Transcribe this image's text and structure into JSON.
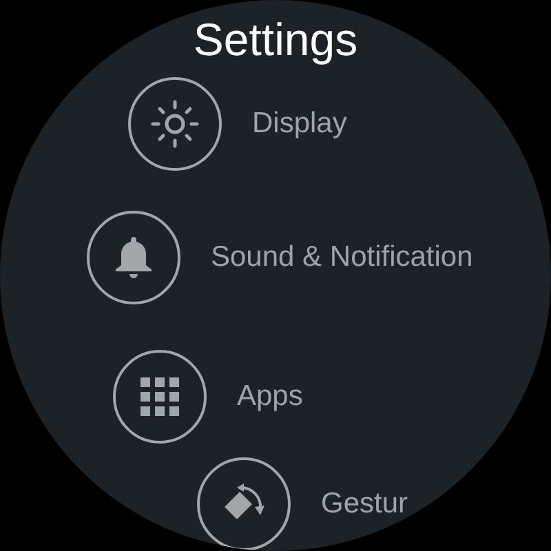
{
  "title": "Settings",
  "items": [
    {
      "label": "Display",
      "kind": "display"
    },
    {
      "label": "Sound & Notification",
      "kind": "sound"
    },
    {
      "label": "Apps",
      "kind": "apps"
    },
    {
      "label": "Gestur",
      "kind": "gestures"
    }
  ]
}
